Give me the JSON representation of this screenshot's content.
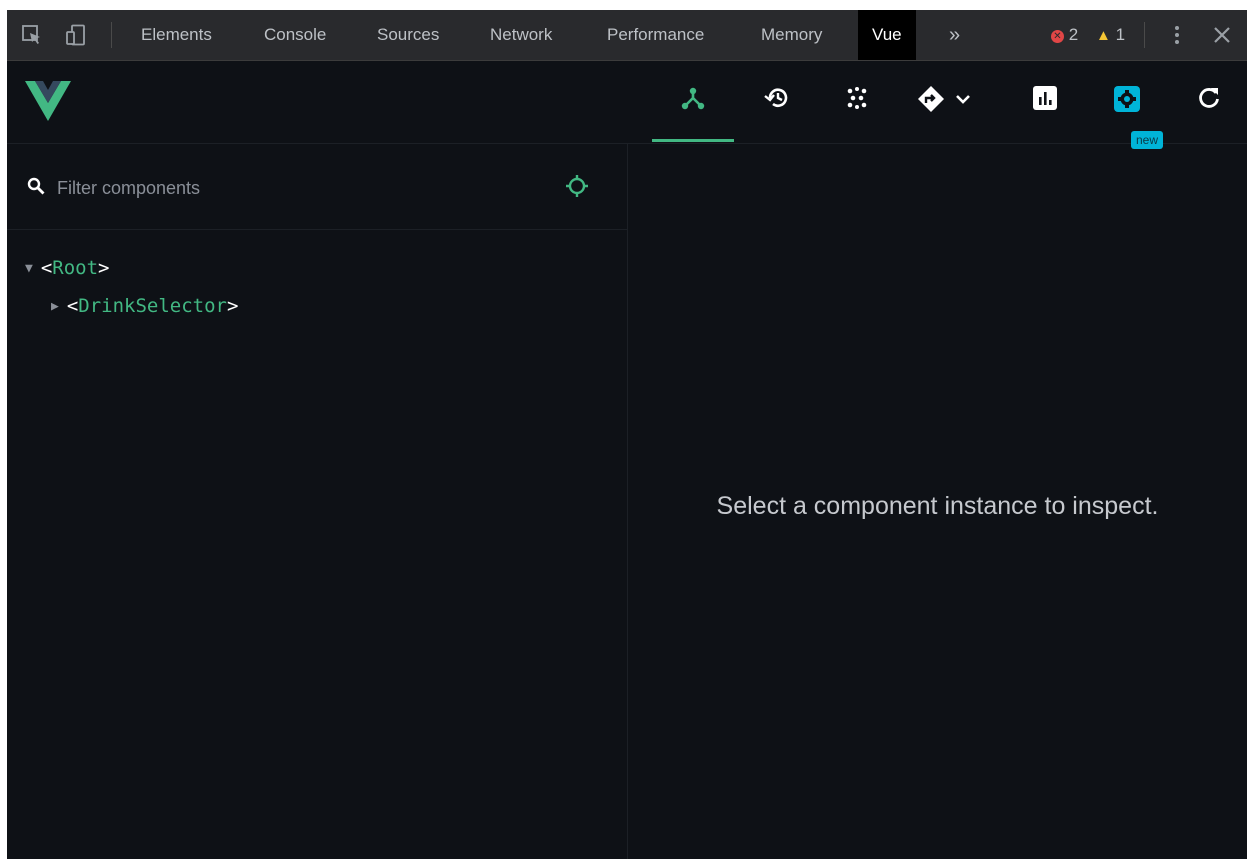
{
  "devtools_tabs": [
    "Elements",
    "Console",
    "Sources",
    "Network",
    "Performance",
    "Memory",
    "Vue"
  ],
  "active_tab": "Vue",
  "more_tabs_glyph": "»",
  "errors_count": "2",
  "warnings_count": "1",
  "colors": {
    "vue_green": "#42b883",
    "vue_dark": "#35495e",
    "background": "#0e1116",
    "new_badge": "#00b4d8",
    "error_red": "#e04646",
    "warning_yellow": "#f4c534"
  },
  "vue_toolbar": {
    "buttons": [
      "components-tree-icon",
      "timeline-history-icon",
      "plugins-dots-icon",
      "router-icon",
      "performance-chart-icon",
      "settings-icon",
      "refresh-icon"
    ],
    "new_badge": "new"
  },
  "filter": {
    "placeholder": "Filter components",
    "value": ""
  },
  "tree": [
    {
      "open_bracket": "<",
      "name": "Root",
      "close_bracket": ">",
      "expanded": true,
      "depth": 0
    },
    {
      "open_bracket": "<",
      "name": "DrinkSelector",
      "close_bracket": ">",
      "expanded": false,
      "depth": 1
    }
  ],
  "inspector": {
    "empty_message": "Select a component instance to inspect."
  }
}
